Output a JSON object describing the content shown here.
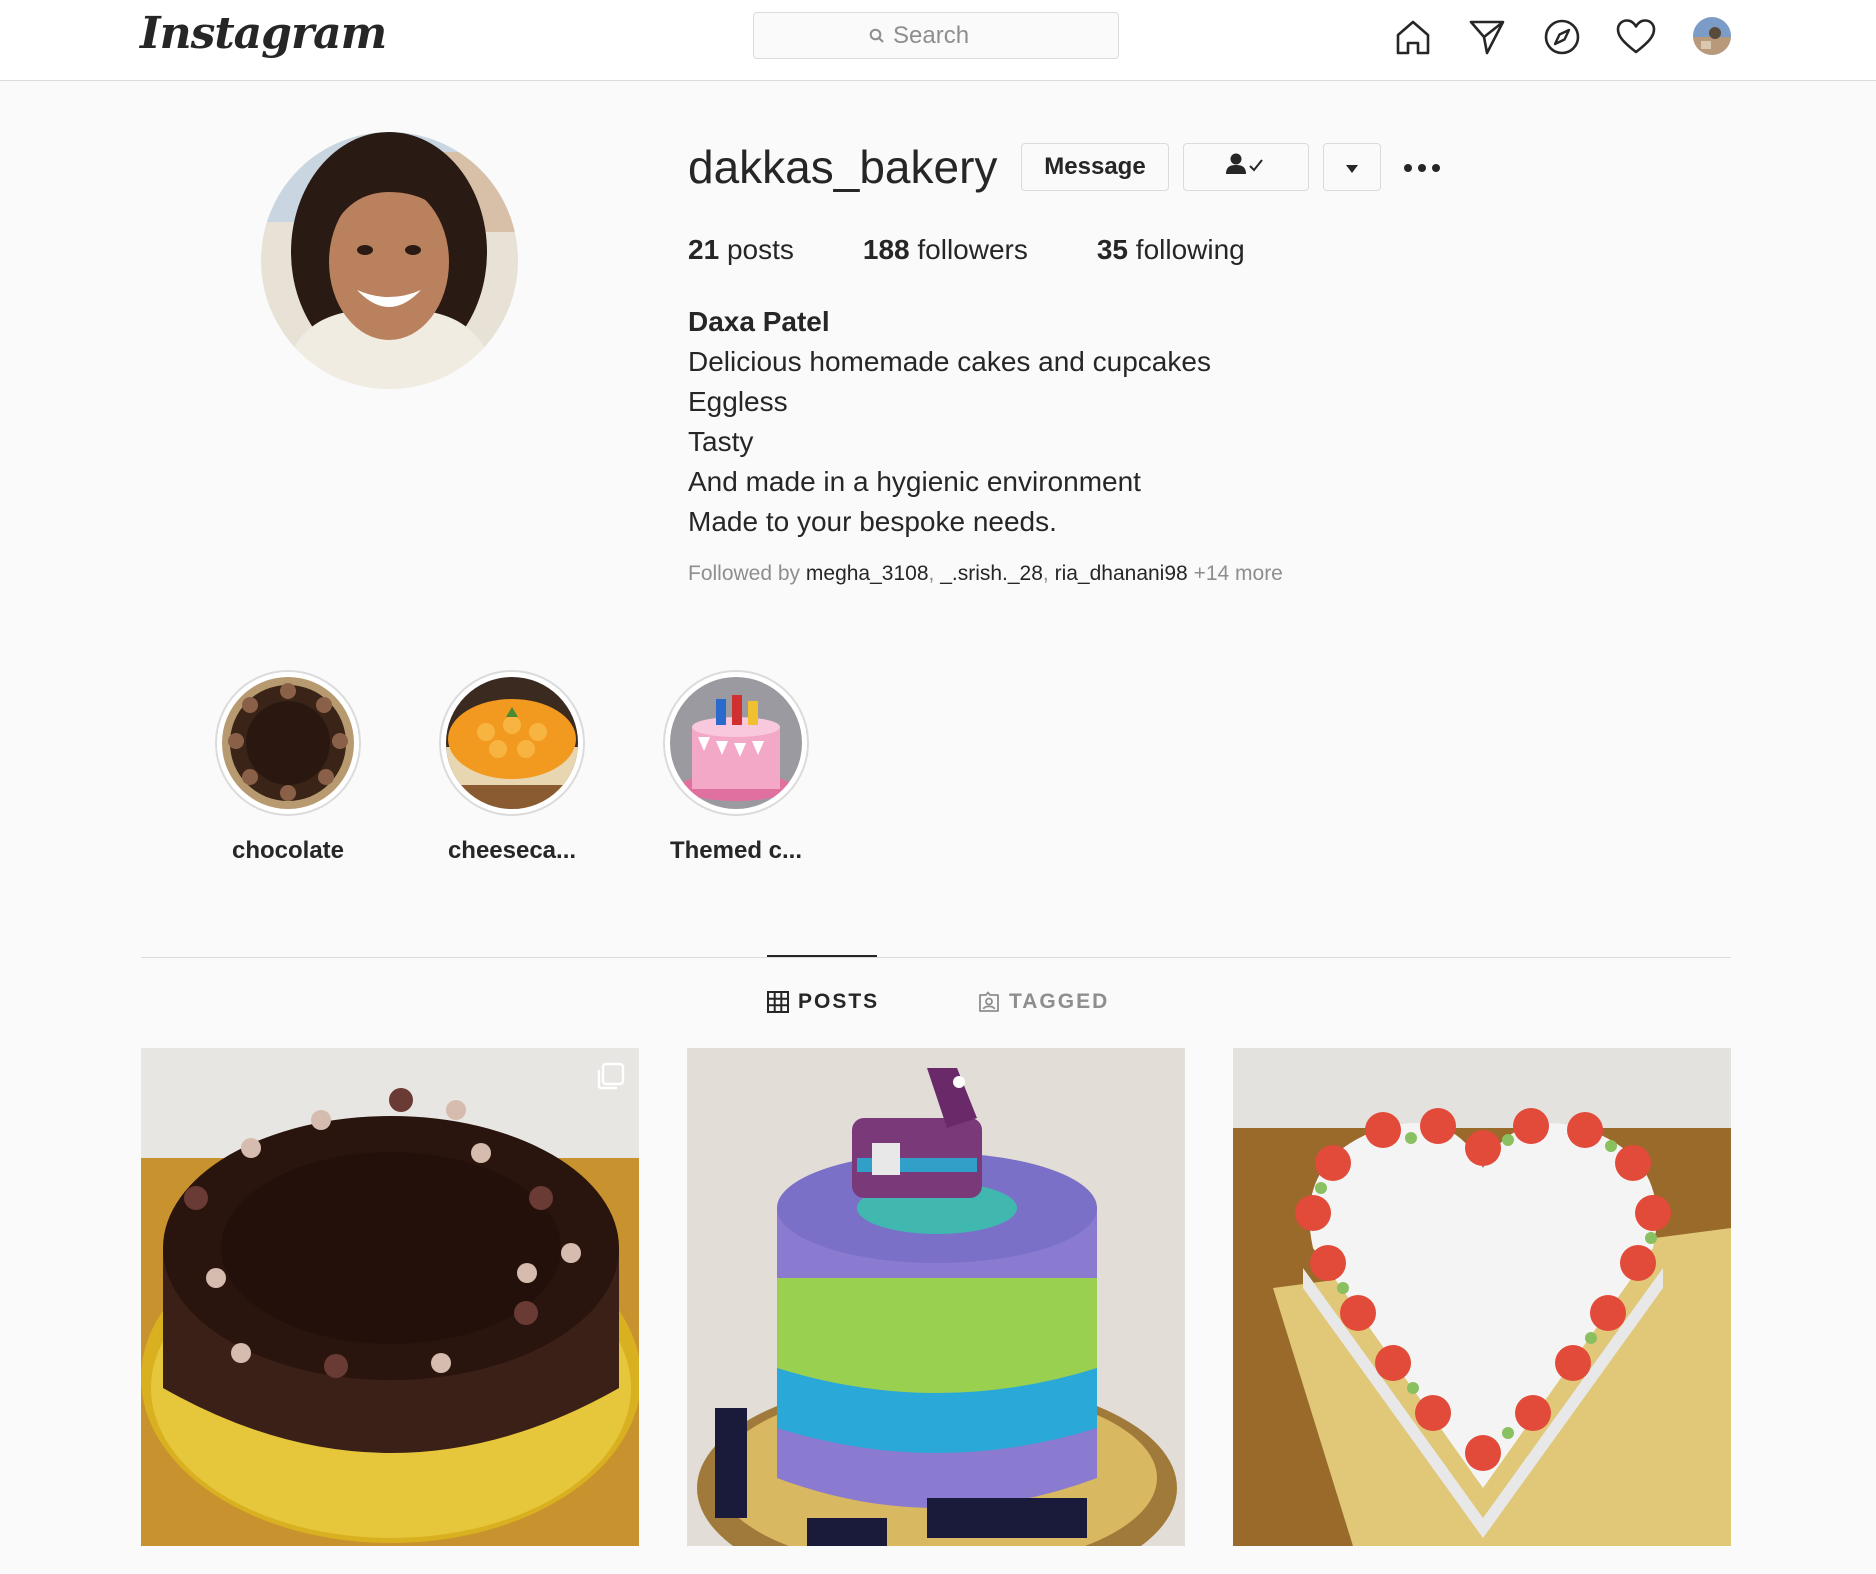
{
  "nav": {
    "logo": "Instagram",
    "search_placeholder": "Search"
  },
  "profile": {
    "username": "dakkas_bakery",
    "message_button": "Message",
    "stats": {
      "posts_count": "21",
      "posts_label": "posts",
      "followers_count": "188",
      "followers_label": "followers",
      "following_count": "35",
      "following_label": "following"
    },
    "full_name": "Daxa Patel",
    "bio_lines": [
      "Delicious homemade cakes and cupcakes",
      "Eggless",
      "Tasty",
      "And made in a hygienic environment",
      "Made to your bespoke needs."
    ],
    "followed_by": {
      "prefix": "Followed by",
      "names": [
        "megha_3108",
        "_.srish._28",
        "ria_dhanani98"
      ],
      "more": "+14 more"
    }
  },
  "highlights": [
    {
      "label": "chocolate"
    },
    {
      "label": "cheeseca..."
    },
    {
      "label": "Themed c..."
    }
  ],
  "tabs": {
    "posts": "POSTS",
    "tagged": "TAGGED"
  },
  "colors": {
    "text": "#262626",
    "muted": "#8e8e8e",
    "border": "#dbdbdb",
    "background": "#fafafa"
  }
}
